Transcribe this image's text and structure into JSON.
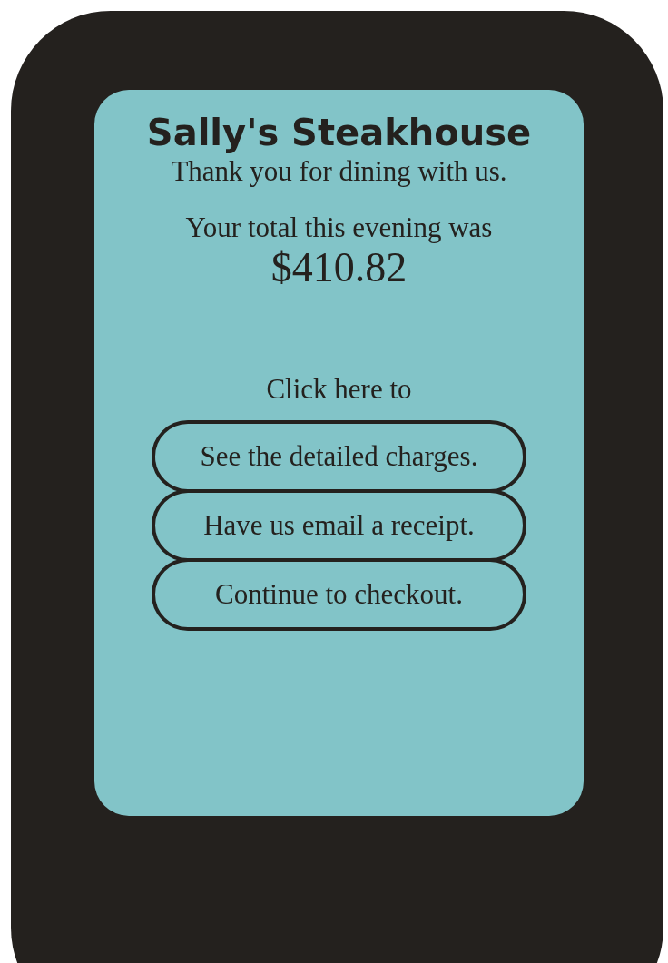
{
  "restaurant": {
    "name": "Sally's Steakhouse",
    "thanks": "Thank you for dining with us."
  },
  "total": {
    "label": "Your total this evening was",
    "amount": "$410.82"
  },
  "prompt": "Click here to",
  "buttons": [
    {
      "label": "See the detailed charges."
    },
    {
      "label": "Have us email a receipt."
    },
    {
      "label": "Continue to checkout."
    }
  ]
}
